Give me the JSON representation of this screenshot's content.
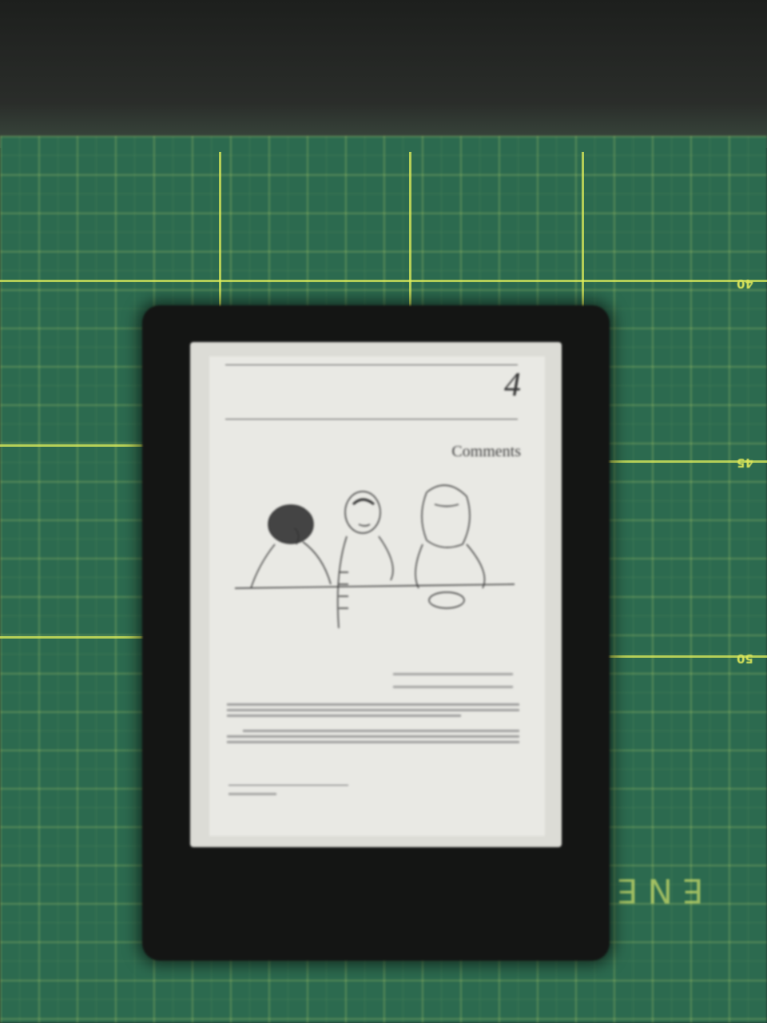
{
  "scene": {
    "description_role": "photo of an e-reader lying on a green cutting mat",
    "mat_color": "#2c6a4f",
    "grid_color": "#d9e45a",
    "device_color": "#141514"
  },
  "mat_ruler": {
    "numbers": [
      "40",
      "45",
      "50"
    ]
  },
  "ereader": {
    "chapter_number": "4",
    "chapter_title": "Comments",
    "page_number": ""
  }
}
